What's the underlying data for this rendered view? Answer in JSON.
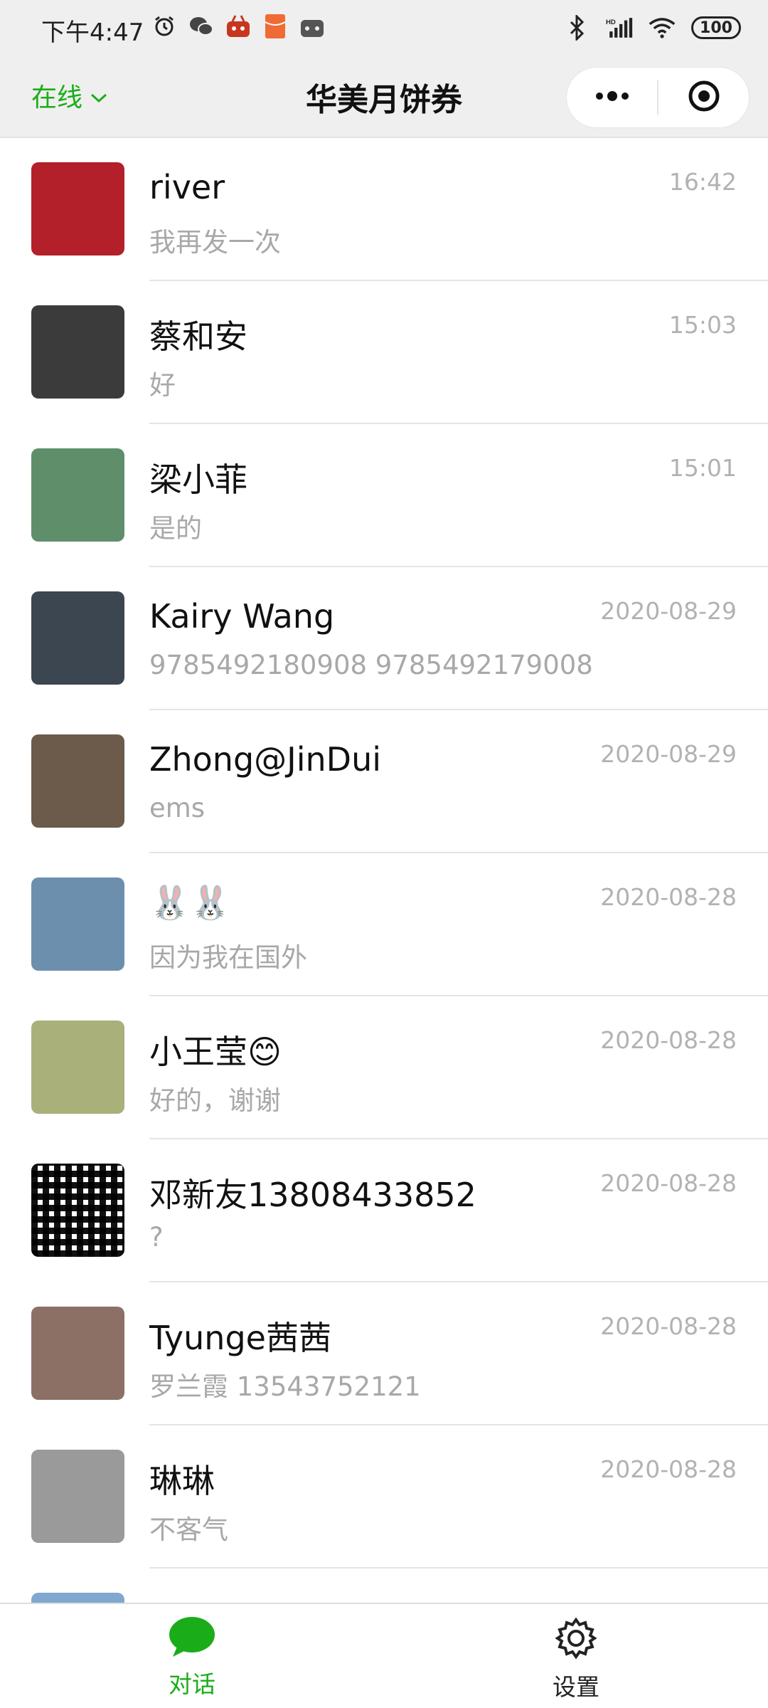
{
  "status_bar": {
    "time": "下午4:47",
    "left_icons": [
      "alarm-icon",
      "wechat-icon",
      "app-notification-icon",
      "red-packet-icon",
      "game-controller-icon"
    ],
    "right_icons": [
      "bluetooth-icon",
      "hd-signal-icon",
      "wifi-icon"
    ],
    "battery": "100"
  },
  "header": {
    "status_label": "在线",
    "title": "华美月饼券",
    "menu_icon": "more-icon",
    "close_icon": "target-icon"
  },
  "chats": [
    {
      "name": "river",
      "preview": "我再发一次",
      "time": "16:42",
      "avatar_color": "#b3202a"
    },
    {
      "name": "蔡和安",
      "preview": "好",
      "time": "15:03",
      "avatar_color": "#3b3b3b"
    },
    {
      "name": "梁小菲",
      "preview": "是的",
      "time": "15:01",
      "avatar_color": "#5f8f6a"
    },
    {
      "name": "Kairy Wang",
      "preview": "9785492180908 9785492179008",
      "time": "2020-08-29",
      "avatar_color": "#3c4650"
    },
    {
      "name": "Zhong@JinDui",
      "preview": "ems",
      "time": "2020-08-29",
      "avatar_color": "#6c5a4a"
    },
    {
      "name": "🐰🐰",
      "preview": "因为我在国外",
      "time": "2020-08-28",
      "avatar_color": "#6d8fae"
    },
    {
      "name": "小王莹😊",
      "preview": "好的，谢谢",
      "time": "2020-08-28",
      "avatar_color": "#a9b07a"
    },
    {
      "name": "邓新友13808433852",
      "preview": "?",
      "time": "2020-08-28",
      "avatar_color": "#ffffff"
    },
    {
      "name": "Tyunge茜茜",
      "preview": "罗兰霞 13543752121",
      "time": "2020-08-28",
      "avatar_color": "#8c7066"
    },
    {
      "name": "琳琳",
      "preview": "不客气",
      "time": "2020-08-28",
      "avatar_color": "#9a9a9a"
    },
    {
      "name": "",
      "preview": "",
      "time": "",
      "avatar_color": "#7fa8d0"
    }
  ],
  "tabs": [
    {
      "label": "对话",
      "icon": "chat-bubble-icon",
      "active": true
    },
    {
      "label": "设置",
      "icon": "gear-icon",
      "active": false
    }
  ],
  "colors": {
    "accent": "#1aad19",
    "header_bg": "#efefef",
    "secondary_text": "#a8a8a8"
  }
}
